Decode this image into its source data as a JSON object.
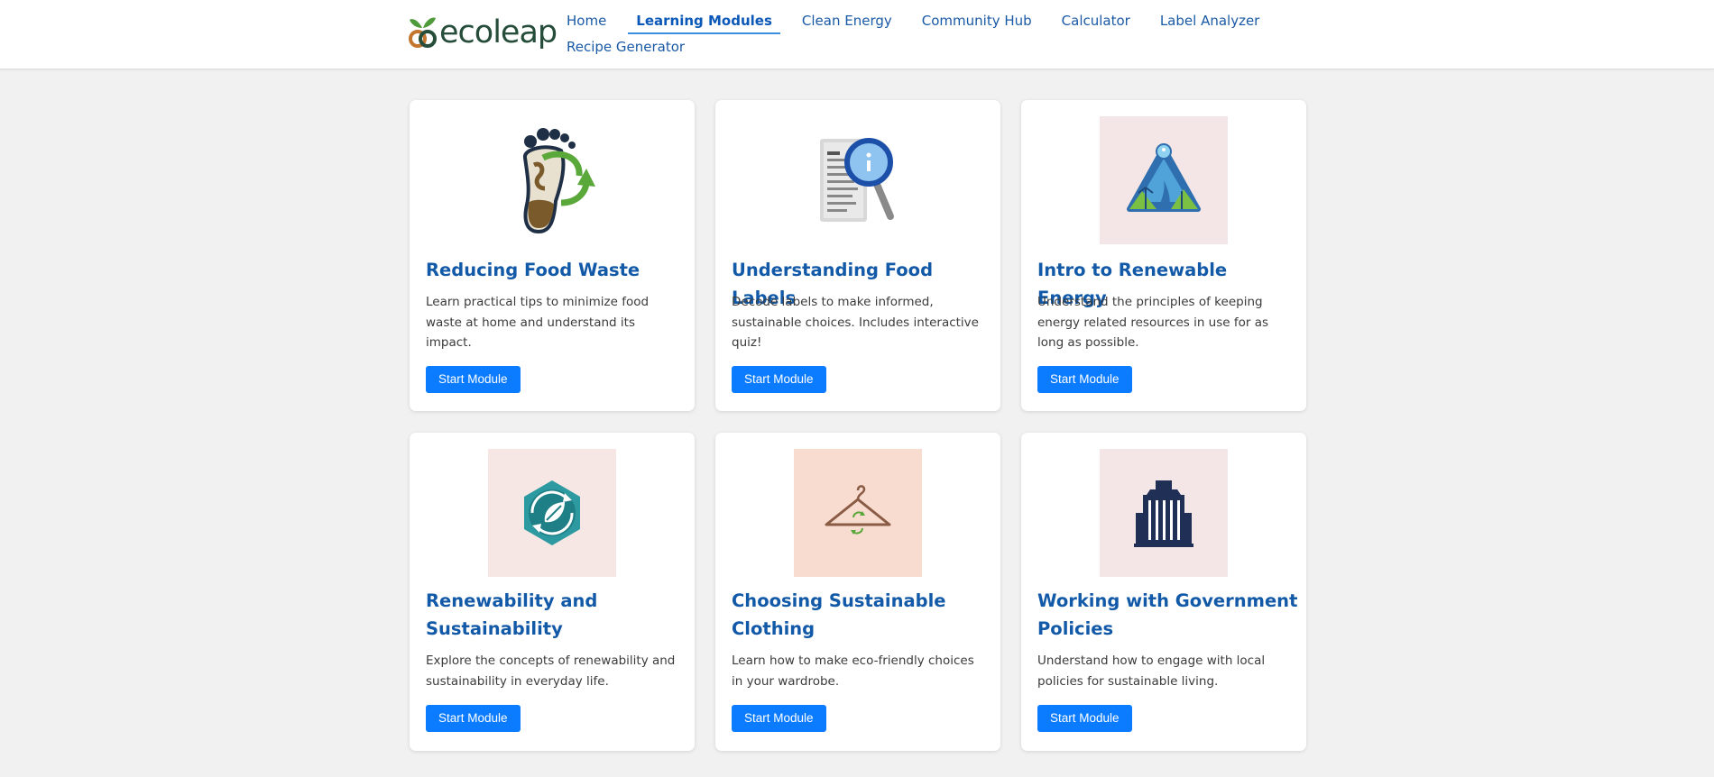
{
  "brand": {
    "name": "ecoleap"
  },
  "nav": {
    "items": [
      {
        "label": "Home"
      },
      {
        "label": "Learning Modules",
        "active": true
      },
      {
        "label": "Clean Energy"
      },
      {
        "label": "Community Hub"
      },
      {
        "label": "Calculator"
      },
      {
        "label": "Label Analyzer"
      },
      {
        "label": "Recipe Generator"
      }
    ]
  },
  "modules": [
    {
      "title": "Reducing Food Waste",
      "description": "Learn practical tips to minimize food waste at home and understand its impact.",
      "button": "Start Module",
      "icon": "footprint-recycle-icon"
    },
    {
      "title": "Understanding Food Labels",
      "description": "Decode labels to make informed, sustainable choices. Includes interactive quiz!",
      "button": "Start Module",
      "icon": "label-magnifier-icon"
    },
    {
      "title": "Intro to Renewable Energy",
      "description": "Understand the principles of keeping energy related resources in use for as long as possible.",
      "button": "Start Module",
      "icon": "renewable-landscape-icon"
    },
    {
      "title": "Renewability and Sustainability",
      "description": "Explore the concepts of renewability and sustainability in everyday life.",
      "button": "Start Module",
      "icon": "leaf-cycle-icon"
    },
    {
      "title": "Choosing Sustainable Clothing",
      "description": "Learn how to make eco-friendly choices in your wardrobe.",
      "button": "Start Module",
      "icon": "hanger-recycle-icon"
    },
    {
      "title": "Working with Government Policies",
      "description": "Understand how to engage with local policies for sustainable living.",
      "button": "Start Module",
      "icon": "government-building-icon"
    }
  ],
  "colors": {
    "accent": "#0b7bff",
    "title": "#1259a8",
    "nav": "#1a5aa6",
    "logo": "#264d3a"
  }
}
